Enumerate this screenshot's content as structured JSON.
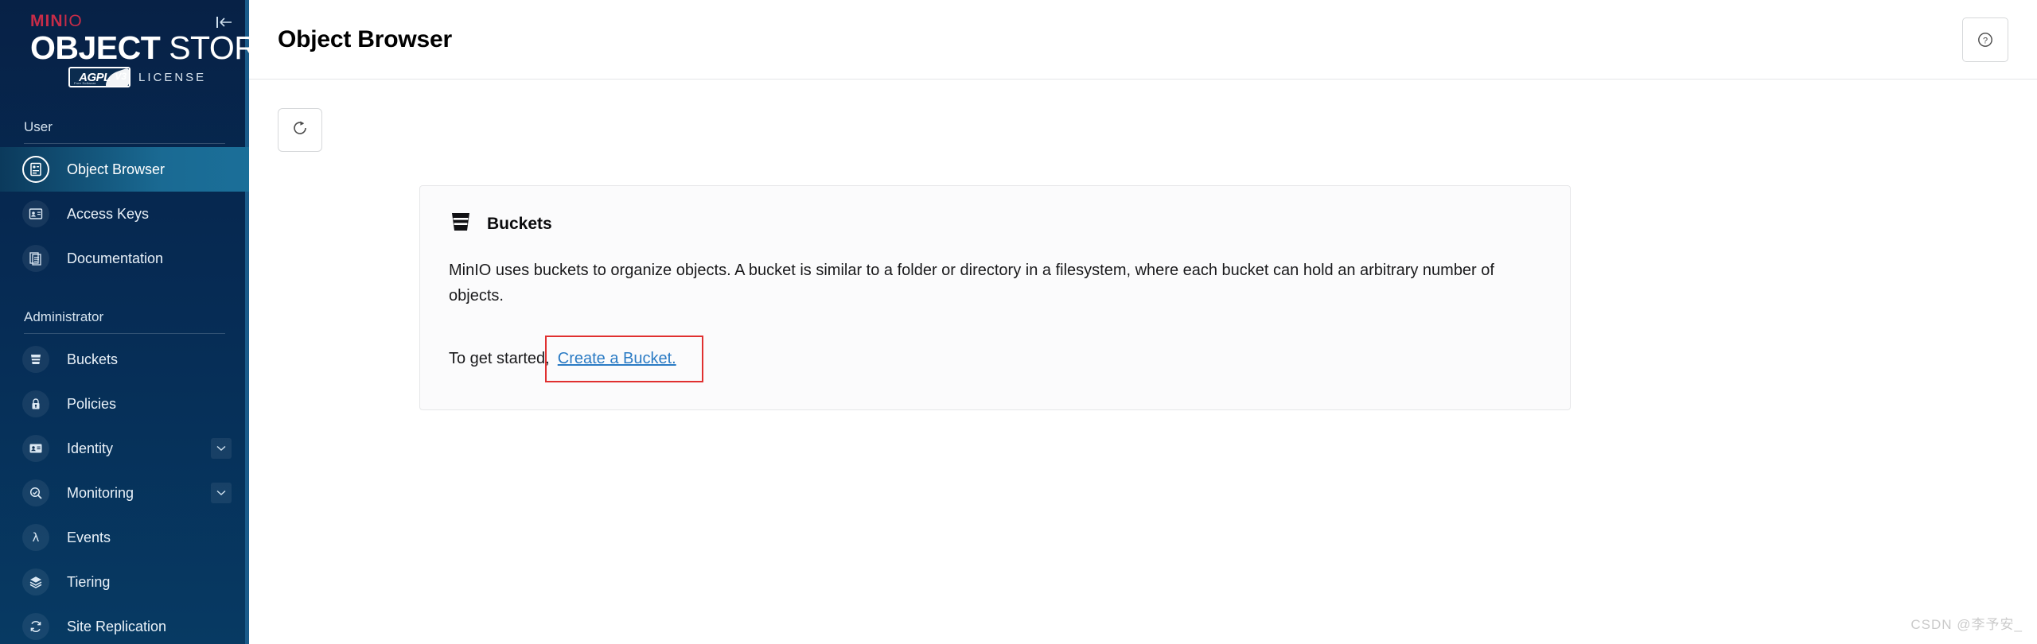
{
  "brand": {
    "name_prefix": "MIN",
    "name_suffix": "IO",
    "product_line1_bold": "OBJECT",
    "product_line1_thin": " STORE",
    "license_badge": "AGPL",
    "license_badge_sub": "Free Software",
    "license_badge_version": "V3",
    "license_label": "LICENSE"
  },
  "sidebar": {
    "collapse_icon": "collapse-left-icon",
    "sections": [
      {
        "label": "User",
        "items": [
          {
            "label": "Object Browser",
            "icon": "object-browser-icon",
            "active": true,
            "expandable": false
          },
          {
            "label": "Access Keys",
            "icon": "access-keys-icon",
            "active": false,
            "expandable": false
          },
          {
            "label": "Documentation",
            "icon": "documentation-icon",
            "active": false,
            "expandable": false
          }
        ]
      },
      {
        "label": "Administrator",
        "items": [
          {
            "label": "Buckets",
            "icon": "bucket-icon",
            "active": false,
            "expandable": false
          },
          {
            "label": "Policies",
            "icon": "lock-icon",
            "active": false,
            "expandable": false
          },
          {
            "label": "Identity",
            "icon": "identity-card-icon",
            "active": false,
            "expandable": true
          },
          {
            "label": "Monitoring",
            "icon": "magnifier-icon",
            "active": false,
            "expandable": true
          },
          {
            "label": "Events",
            "icon": "lambda-icon",
            "active": false,
            "expandable": false
          },
          {
            "label": "Tiering",
            "icon": "layers-icon",
            "active": false,
            "expandable": false
          },
          {
            "label": "Site Replication",
            "icon": "replication-icon",
            "active": false,
            "expandable": false
          }
        ]
      }
    ]
  },
  "header": {
    "title": "Object Browser",
    "help_icon": "help-circle-icon"
  },
  "toolbar": {
    "refresh_icon": "refresh-icon"
  },
  "card": {
    "icon": "bucket-icon",
    "title": "Buckets",
    "description": "MinIO uses buckets to organize objects. A bucket is similar to a folder or directory in a filesystem, where each bucket can hold an arbitrary number of objects.",
    "cta_prefix": "To get started,",
    "cta_link": "Create a Bucket.",
    "highlight_color": "#e03030",
    "link_color": "#2b7bc4"
  },
  "watermark": "CSDN @李予安_"
}
